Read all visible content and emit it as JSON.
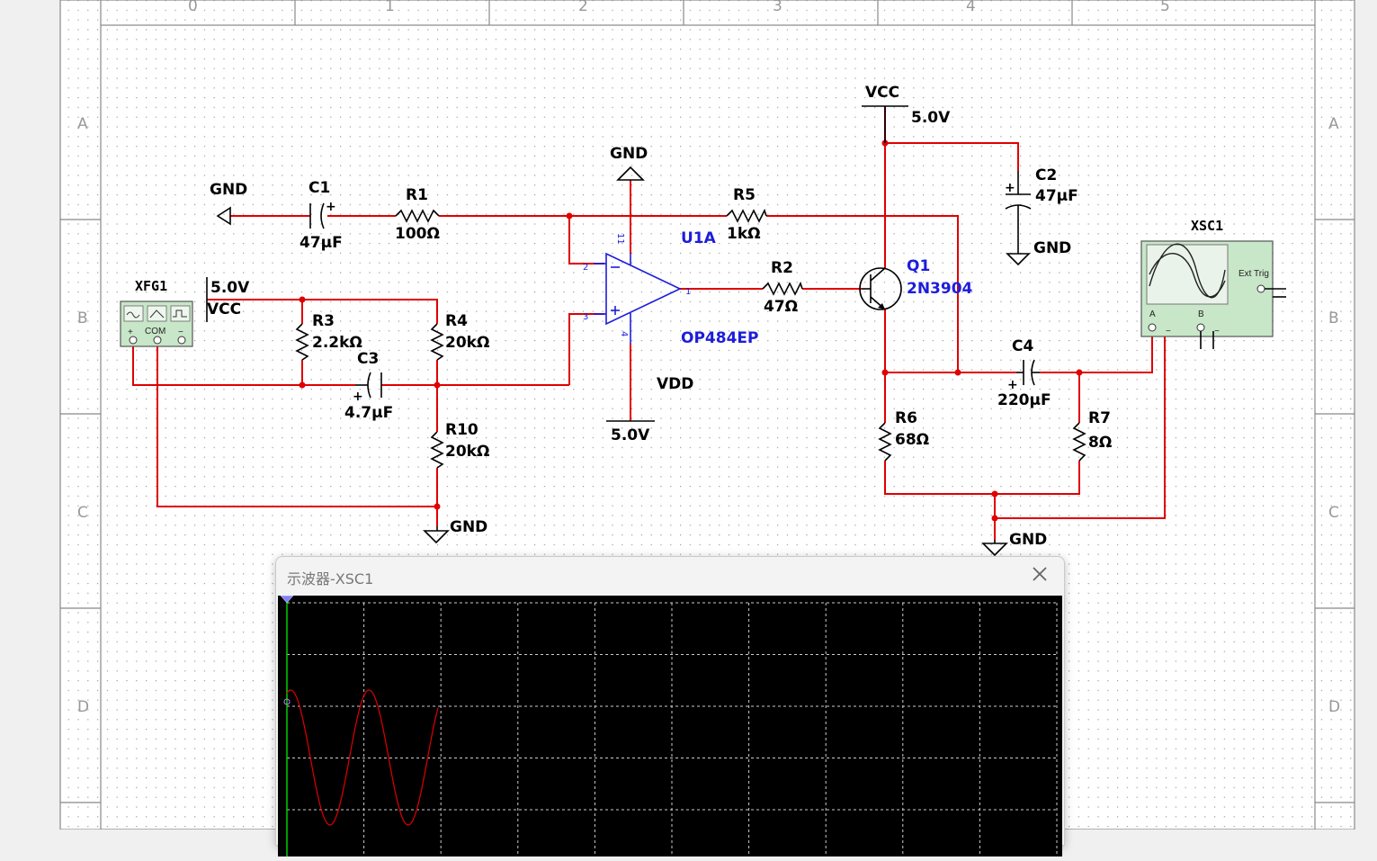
{
  "sheet": {
    "col_labels": [
      "0",
      "1",
      "2",
      "3",
      "4",
      "5"
    ],
    "row_labels": [
      "A",
      "B",
      "C",
      "D"
    ]
  },
  "components": {
    "gnd_left": "GND",
    "c1": {
      "ref": "C1",
      "value": "47µF"
    },
    "r1": {
      "ref": "R1",
      "value": "100Ω"
    },
    "gnd_u1": "GND",
    "r5": {
      "ref": "R5",
      "value": "1kΩ"
    },
    "vcc_top": "VCC",
    "vcc_top_value": "5.0V",
    "c2": {
      "ref": "C2",
      "value": "47µF"
    },
    "gnd_c2": "GND",
    "xsc1": "XSC1",
    "xsc1_ext_trig": "Ext Trig",
    "xsc1_a": "A",
    "xsc1_b": "B",
    "xfg1": "XFG1",
    "xfg1_com": "COM",
    "vcc_left_value": "5.0V",
    "vcc_left": "VCC",
    "r3": {
      "ref": "R3",
      "value": "2.2kΩ"
    },
    "r4": {
      "ref": "R4",
      "value": "20kΩ"
    },
    "c3": {
      "ref": "C3",
      "value": "4.7µF"
    },
    "r10": {
      "ref": "R10",
      "value": "20kΩ"
    },
    "gnd_r10": "GND",
    "u1a": {
      "ref": "U1A",
      "model": "OP484EP",
      "pin11": "11",
      "pin2": "2",
      "pin3": "3",
      "pin1": "1",
      "pin4": "4"
    },
    "vdd": "VDD",
    "vdd_value": "5.0V",
    "r2": {
      "ref": "R2",
      "value": "47Ω"
    },
    "q1": {
      "ref": "Q1",
      "model": "2N3904"
    },
    "c4": {
      "ref": "C4",
      "value": "220µF"
    },
    "r6": {
      "ref": "R6",
      "value": "68Ω"
    },
    "r7": {
      "ref": "R7",
      "value": "8Ω"
    },
    "gnd_out": "GND"
  },
  "scope_window": {
    "title": "示波器-XSC1",
    "close_icon": "close-icon",
    "trace_color": "#e00000",
    "grid_color": "#cccccc"
  }
}
